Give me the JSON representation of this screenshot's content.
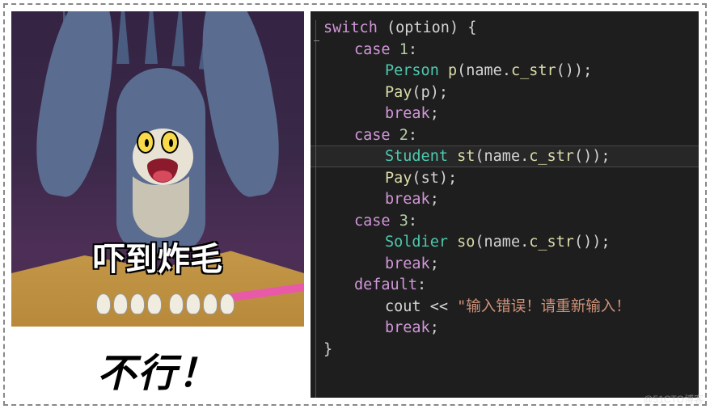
{
  "meme": {
    "overlay_text": "吓到炸毛",
    "caption": "不行！"
  },
  "code": {
    "lines": {
      "l1_kw": "switch",
      "l1_punc": " (",
      "l1_var": "option",
      "l1_punc2": ") {",
      "l2_kw": "case",
      "l2_num": " 1",
      "l2_c": ":",
      "l3_type": "Person",
      "l3_sp": " ",
      "l3_fn": "p",
      "l3_p1": "(",
      "l3_var": "name",
      "l3_dot": ".",
      "l3_fn2": "c_str",
      "l3_p2": "());",
      "l4_fn": "Pay",
      "l4_p1": "(",
      "l4_var": "p",
      "l4_p2": ");",
      "l5_kw": "break",
      "l5_c": ";",
      "l6_kw": "case",
      "l6_num": " 2",
      "l6_c": ":",
      "l7_type": "Student",
      "l7_sp": " ",
      "l7_fn": "st",
      "l7_p1": "(",
      "l7_var": "name",
      "l7_dot": ".",
      "l7_fn2": "c_str",
      "l7_p2": "());",
      "l8_fn": "Pay",
      "l8_p1": "(",
      "l8_var": "st",
      "l8_p2": ");",
      "l9_kw": "break",
      "l9_c": ";",
      "l10_kw": "case",
      "l10_num": " 3",
      "l10_c": ":",
      "l11_type": "Soldier",
      "l11_sp": " ",
      "l11_fn": "so",
      "l11_p1": "(",
      "l11_var": "name",
      "l11_dot": ".",
      "l11_fn2": "c_str",
      "l11_p2": "());",
      "l12_kw": "break",
      "l12_c": ";",
      "l13_kw": "default",
      "l13_c": ":",
      "l14_var": "cout",
      "l14_op": " << ",
      "l14_str": "\"输入错误！请重新输入！",
      "l15_kw": "break",
      "l15_c": ";",
      "l16_brace": "}"
    },
    "highlighted_line_index": 5
  },
  "watermark": "@51CTO博客"
}
